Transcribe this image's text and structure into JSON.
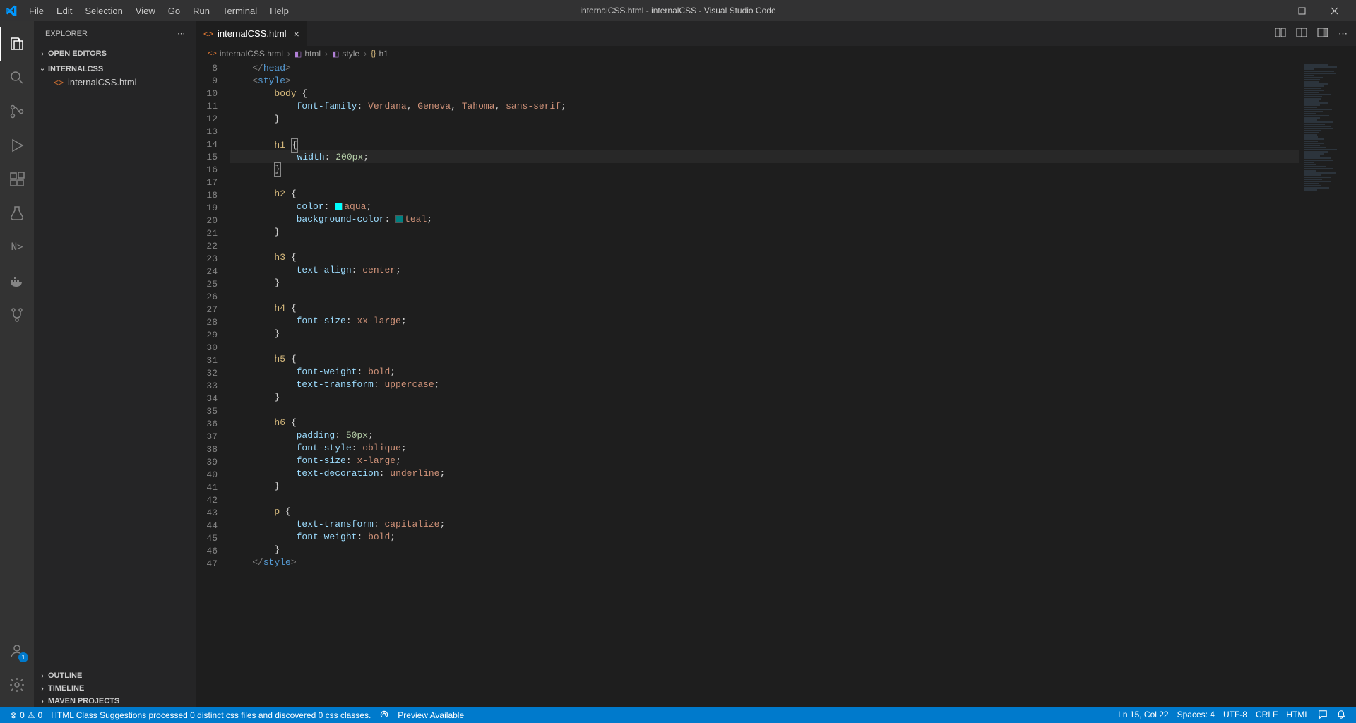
{
  "titlebar": {
    "title": "internalCSS.html - internalCSS - Visual Studio Code",
    "menu": [
      "File",
      "Edit",
      "Selection",
      "View",
      "Go",
      "Run",
      "Terminal",
      "Help"
    ]
  },
  "activitybar": {
    "items": [
      {
        "name": "explorer-icon",
        "active": true
      },
      {
        "name": "search-icon",
        "active": false
      },
      {
        "name": "source-control-icon",
        "active": false
      },
      {
        "name": "debug-icon",
        "active": false
      },
      {
        "name": "extensions-icon",
        "active": false
      },
      {
        "name": "test-icon",
        "active": false
      },
      {
        "name": "nx-icon",
        "active": false
      },
      {
        "name": "docker-icon",
        "active": false
      },
      {
        "name": "github-icon",
        "active": false
      }
    ],
    "bottom": [
      {
        "name": "account-icon",
        "badge": "1"
      },
      {
        "name": "settings-gear-icon"
      }
    ]
  },
  "sidebar": {
    "title": "EXPLORER",
    "sections": {
      "openEditors": "OPEN EDITORS",
      "project": "INTERNALCSS",
      "outline": "OUTLINE",
      "timeline": "TIMELINE",
      "maven": "MAVEN PROJECTS"
    },
    "files": [
      {
        "name": "internalCSS.html"
      }
    ]
  },
  "tabs": [
    {
      "name": "internalCSS.html",
      "active": true
    }
  ],
  "breadcrumb": [
    {
      "label": "internalCSS.html",
      "icon": "orange"
    },
    {
      "label": "html",
      "icon": "purple"
    },
    {
      "label": "style",
      "icon": "purple"
    },
    {
      "label": "h1",
      "icon": "yellow"
    }
  ],
  "editor": {
    "startLine": 8,
    "endLine": 47,
    "highlightLine": 15,
    "lines": [
      {
        "n": 8,
        "tokens": [
          [
            "    ",
            ""
          ],
          [
            "</",
            "bracket"
          ],
          [
            "head",
            "tag"
          ],
          [
            ">",
            "bracket"
          ]
        ]
      },
      {
        "n": 9,
        "tokens": [
          [
            "    ",
            ""
          ],
          [
            "<",
            "bracket"
          ],
          [
            "style",
            "tag"
          ],
          [
            ">",
            "bracket"
          ]
        ]
      },
      {
        "n": 10,
        "tokens": [
          [
            "        ",
            ""
          ],
          [
            "body",
            "sel"
          ],
          [
            " {",
            "punc"
          ]
        ]
      },
      {
        "n": 11,
        "tokens": [
          [
            "            ",
            ""
          ],
          [
            "font-family",
            "prop"
          ],
          [
            ": ",
            "punc"
          ],
          [
            "Verdana",
            "val"
          ],
          [
            ", ",
            "punc"
          ],
          [
            "Geneva",
            "val"
          ],
          [
            ", ",
            "punc"
          ],
          [
            "Tahoma",
            "val"
          ],
          [
            ", ",
            "punc"
          ],
          [
            "sans-serif",
            "val"
          ],
          [
            ";",
            "punc"
          ]
        ]
      },
      {
        "n": 12,
        "tokens": [
          [
            "        ",
            ""
          ],
          [
            "}",
            "punc"
          ]
        ]
      },
      {
        "n": 13,
        "tokens": [
          [
            "",
            ""
          ]
        ]
      },
      {
        "n": 14,
        "tokens": [
          [
            "        ",
            ""
          ],
          [
            "h1",
            "sel"
          ],
          [
            " ",
            "punc"
          ],
          [
            "{",
            "punc",
            "box"
          ]
        ]
      },
      {
        "n": 15,
        "tokens": [
          [
            "            ",
            ""
          ],
          [
            "width",
            "prop"
          ],
          [
            ": ",
            "punc"
          ],
          [
            "200px",
            "num"
          ],
          [
            ";",
            "punc"
          ]
        ],
        "highlight": true
      },
      {
        "n": 16,
        "tokens": [
          [
            "        ",
            ""
          ],
          [
            "}",
            "punc",
            "box"
          ]
        ]
      },
      {
        "n": 17,
        "tokens": [
          [
            "",
            ""
          ]
        ]
      },
      {
        "n": 18,
        "tokens": [
          [
            "        ",
            ""
          ],
          [
            "h2",
            "sel"
          ],
          [
            " {",
            "punc"
          ]
        ]
      },
      {
        "n": 19,
        "tokens": [
          [
            "            ",
            ""
          ],
          [
            "color",
            "prop"
          ],
          [
            ": ",
            "punc"
          ],
          [
            "",
            "swatch",
            "#00ffff"
          ],
          [
            "aqua",
            "val"
          ],
          [
            ";",
            "punc"
          ]
        ]
      },
      {
        "n": 20,
        "tokens": [
          [
            "            ",
            ""
          ],
          [
            "background-color",
            "prop"
          ],
          [
            ": ",
            "punc"
          ],
          [
            "",
            "swatch",
            "#008080"
          ],
          [
            "teal",
            "val"
          ],
          [
            ";",
            "punc"
          ]
        ]
      },
      {
        "n": 21,
        "tokens": [
          [
            "        ",
            ""
          ],
          [
            "}",
            "punc"
          ]
        ]
      },
      {
        "n": 22,
        "tokens": [
          [
            "",
            ""
          ]
        ]
      },
      {
        "n": 23,
        "tokens": [
          [
            "        ",
            ""
          ],
          [
            "h3",
            "sel"
          ],
          [
            " {",
            "punc"
          ]
        ]
      },
      {
        "n": 24,
        "tokens": [
          [
            "            ",
            ""
          ],
          [
            "text-align",
            "prop"
          ],
          [
            ": ",
            "punc"
          ],
          [
            "center",
            "val"
          ],
          [
            ";",
            "punc"
          ]
        ]
      },
      {
        "n": 25,
        "tokens": [
          [
            "        ",
            ""
          ],
          [
            "}",
            "punc"
          ]
        ]
      },
      {
        "n": 26,
        "tokens": [
          [
            "",
            ""
          ]
        ]
      },
      {
        "n": 27,
        "tokens": [
          [
            "        ",
            ""
          ],
          [
            "h4",
            "sel"
          ],
          [
            " {",
            "punc"
          ]
        ]
      },
      {
        "n": 28,
        "tokens": [
          [
            "            ",
            ""
          ],
          [
            "font-size",
            "prop"
          ],
          [
            ": ",
            "punc"
          ],
          [
            "xx-large",
            "val"
          ],
          [
            ";",
            "punc"
          ]
        ]
      },
      {
        "n": 29,
        "tokens": [
          [
            "        ",
            ""
          ],
          [
            "}",
            "punc"
          ]
        ]
      },
      {
        "n": 30,
        "tokens": [
          [
            "",
            ""
          ]
        ]
      },
      {
        "n": 31,
        "tokens": [
          [
            "        ",
            ""
          ],
          [
            "h5",
            "sel"
          ],
          [
            " {",
            "punc"
          ]
        ]
      },
      {
        "n": 32,
        "tokens": [
          [
            "            ",
            ""
          ],
          [
            "font-weight",
            "prop"
          ],
          [
            ": ",
            "punc"
          ],
          [
            "bold",
            "val"
          ],
          [
            ";",
            "punc"
          ]
        ]
      },
      {
        "n": 33,
        "tokens": [
          [
            "            ",
            ""
          ],
          [
            "text-transform",
            "prop"
          ],
          [
            ": ",
            "punc"
          ],
          [
            "uppercase",
            "val"
          ],
          [
            ";",
            "punc"
          ]
        ]
      },
      {
        "n": 34,
        "tokens": [
          [
            "        ",
            ""
          ],
          [
            "}",
            "punc"
          ]
        ]
      },
      {
        "n": 35,
        "tokens": [
          [
            "",
            ""
          ]
        ]
      },
      {
        "n": 36,
        "tokens": [
          [
            "        ",
            ""
          ],
          [
            "h6",
            "sel"
          ],
          [
            " {",
            "punc"
          ]
        ]
      },
      {
        "n": 37,
        "tokens": [
          [
            "            ",
            ""
          ],
          [
            "padding",
            "prop"
          ],
          [
            ": ",
            "punc"
          ],
          [
            "50px",
            "num"
          ],
          [
            ";",
            "punc"
          ]
        ]
      },
      {
        "n": 38,
        "tokens": [
          [
            "            ",
            ""
          ],
          [
            "font-style",
            "prop"
          ],
          [
            ": ",
            "punc"
          ],
          [
            "oblique",
            "val"
          ],
          [
            ";",
            "punc"
          ]
        ]
      },
      {
        "n": 39,
        "tokens": [
          [
            "            ",
            ""
          ],
          [
            "font-size",
            "prop"
          ],
          [
            ": ",
            "punc"
          ],
          [
            "x-large",
            "val"
          ],
          [
            ";",
            "punc"
          ]
        ]
      },
      {
        "n": 40,
        "tokens": [
          [
            "            ",
            ""
          ],
          [
            "text-decoration",
            "prop"
          ],
          [
            ": ",
            "punc"
          ],
          [
            "underline",
            "val"
          ],
          [
            ";",
            "punc"
          ]
        ]
      },
      {
        "n": 41,
        "tokens": [
          [
            "        ",
            ""
          ],
          [
            "}",
            "punc"
          ]
        ]
      },
      {
        "n": 42,
        "tokens": [
          [
            "",
            ""
          ]
        ]
      },
      {
        "n": 43,
        "tokens": [
          [
            "        ",
            ""
          ],
          [
            "p",
            "sel"
          ],
          [
            " {",
            "punc"
          ]
        ]
      },
      {
        "n": 44,
        "tokens": [
          [
            "            ",
            ""
          ],
          [
            "text-transform",
            "prop"
          ],
          [
            ": ",
            "punc"
          ],
          [
            "capitalize",
            "val"
          ],
          [
            ";",
            "punc"
          ]
        ]
      },
      {
        "n": 45,
        "tokens": [
          [
            "            ",
            ""
          ],
          [
            "font-weight",
            "prop"
          ],
          [
            ": ",
            "punc"
          ],
          [
            "bold",
            "val"
          ],
          [
            ";",
            "punc"
          ]
        ]
      },
      {
        "n": 46,
        "tokens": [
          [
            "        ",
            ""
          ],
          [
            "}",
            "punc"
          ]
        ]
      },
      {
        "n": 47,
        "tokens": [
          [
            "    ",
            ""
          ],
          [
            "</",
            "bracket"
          ],
          [
            "style",
            "tag"
          ],
          [
            ">",
            "bracket"
          ]
        ]
      }
    ]
  },
  "statusbar": {
    "left": {
      "errors": "0",
      "warnings": "0",
      "suggestions": "HTML Class Suggestions processed 0 distinct css files and discovered 0 css classes.",
      "preview": "Preview Available"
    },
    "right": {
      "cursor": "Ln 15, Col 22",
      "spaces": "Spaces: 4",
      "encoding": "UTF-8",
      "eol": "CRLF",
      "lang": "HTML"
    }
  }
}
